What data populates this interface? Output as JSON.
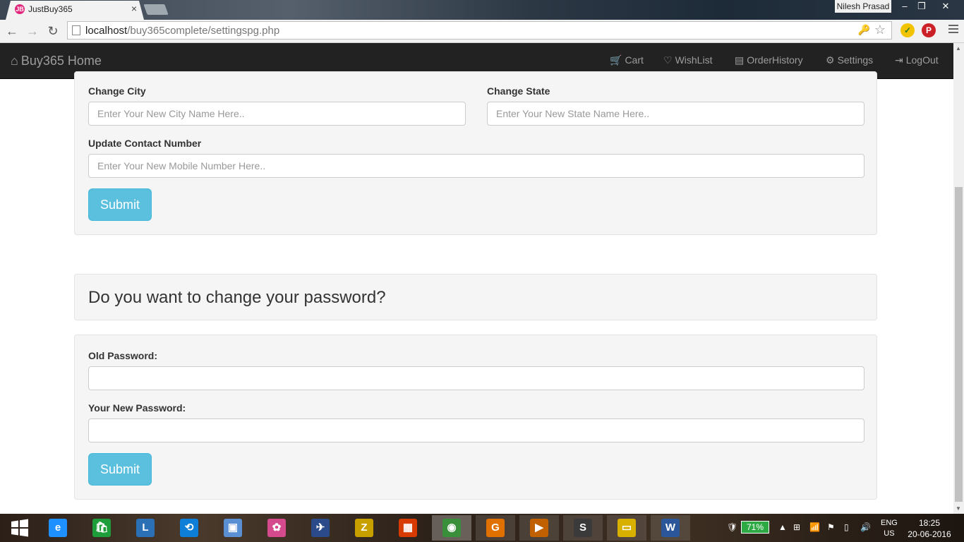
{
  "browser": {
    "tab_title": "JustBuy365",
    "tab_favicon": "JB",
    "tab_close": "×",
    "user_name": "Nilesh Prasad",
    "window_controls": {
      "minimize": "–",
      "restore": "❐",
      "close": "✕"
    },
    "url_host": "localhost",
    "url_path": "/buy365complete/settingspg.php",
    "nav_back": "←",
    "nav_forward": "→",
    "nav_reload": "↻",
    "star": "☆",
    "key": "🔑",
    "ext_norton": "✓",
    "ext_pinterest": "P"
  },
  "navbar": {
    "brand": "Buy365 Home",
    "brand_icon": "⌂",
    "links": [
      {
        "icon": "🛒",
        "label": "Cart"
      },
      {
        "icon": "♡",
        "label": "WishList"
      },
      {
        "icon": "▤",
        "label": "OrderHistory"
      },
      {
        "icon": "⚙",
        "label": "Settings"
      },
      {
        "icon": "⇥",
        "label": "LogOut"
      }
    ]
  },
  "address_form": {
    "city_label": "Change City",
    "city_placeholder": "Enter Your New City Name Here..",
    "state_label": "Change State",
    "state_placeholder": "Enter Your New State Name Here..",
    "contact_label": "Update Contact Number",
    "contact_placeholder": "Enter Your New Mobile Number Here..",
    "submit": "Submit"
  },
  "password_heading": "Do you want to change your password?",
  "password_form": {
    "old_label": "Old Password:",
    "new_label": "Your New Password:",
    "submit": "Submit"
  },
  "taskbar": {
    "start_icon": "windows-logo-icon",
    "apps": [
      {
        "name": "internet-explorer",
        "glyph": "e",
        "color": "#1e90ff"
      },
      {
        "name": "store",
        "glyph": "🛍",
        "color": "#1e9e3a"
      },
      {
        "name": "lenovo",
        "glyph": "L",
        "color": "#2b6fb5"
      },
      {
        "name": "teamviewer",
        "glyph": "⟲",
        "color": "#0e7fd8"
      },
      {
        "name": "virtualbox",
        "glyph": "▣",
        "color": "#5b8fd4"
      },
      {
        "name": "picasa",
        "glyph": "✿",
        "color": "#d44a8c"
      },
      {
        "name": "bird-app",
        "glyph": "✈",
        "color": "#2a4a8a"
      },
      {
        "name": "winzip",
        "glyph": "Z",
        "color": "#c8a000"
      },
      {
        "name": "office",
        "glyph": "▦",
        "color": "#d83b01"
      },
      {
        "name": "chrome",
        "glyph": "◉",
        "color": "#3a8f3a"
      },
      {
        "name": "foxit-pdf",
        "glyph": "G",
        "color": "#e07000"
      },
      {
        "name": "media-player",
        "glyph": "▶",
        "color": "#c06000"
      },
      {
        "name": "sublime-text",
        "glyph": "S",
        "color": "#3a3a3a"
      },
      {
        "name": "file-explorer",
        "glyph": "▭",
        "color": "#d8b000"
      },
      {
        "name": "word",
        "glyph": "W",
        "color": "#2b579a"
      }
    ],
    "battery": "71%",
    "lang_top": "ENG",
    "lang_bottom": "US",
    "time": "18:25",
    "date": "20-06-2016"
  }
}
